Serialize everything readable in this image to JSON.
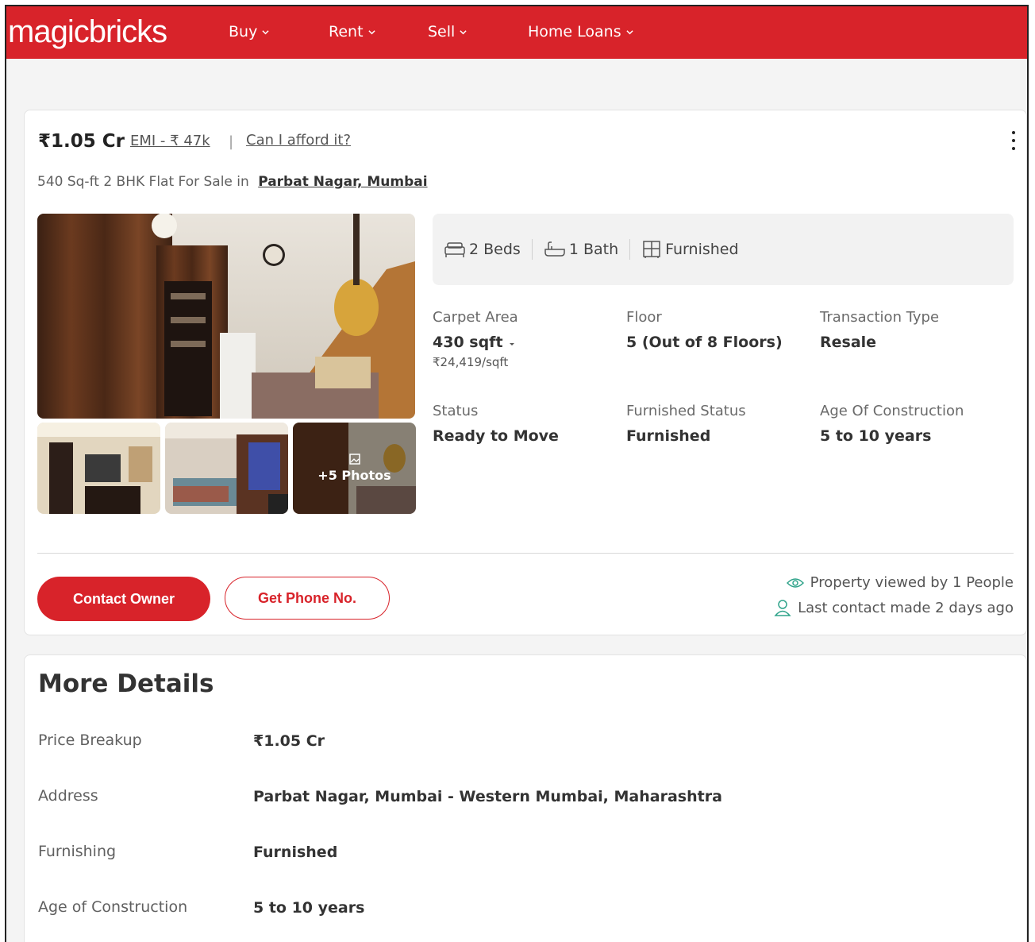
{
  "header": {
    "logo": "magicbricks",
    "nav": [
      "Buy",
      "Rent",
      "Sell",
      "Home Loans"
    ],
    "brand_color": "#d8232a"
  },
  "listing": {
    "price": "₹1.05 Cr",
    "emi": "EMI - ₹ 47k",
    "separator": "|",
    "afford": "Can I afford it?",
    "title": "540 Sq-ft 2 BHK Flat For Sale in",
    "location": "Parbat Nagar, Mumbai",
    "photos_label": "+5 Photos",
    "summary": {
      "beds": "2 Beds",
      "bath": "1 Bath",
      "furnished": "Furnished"
    },
    "attributes": {
      "carpet_area_label": "Carpet Area",
      "carpet_area_value": "430 sqft",
      "carpet_area_rate": "₹24,419/sqft",
      "floor_label": "Floor",
      "floor_value": "5 (Out of 8 Floors)",
      "transaction_label": "Transaction Type",
      "transaction_value": "Resale",
      "status_label": "Status",
      "status_value": "Ready to Move",
      "furnished_status_label": "Furnished Status",
      "furnished_status_value": "Furnished",
      "age_label": "Age Of Construction",
      "age_value": "5 to 10 years"
    },
    "actions": {
      "contact_owner": "Contact Owner",
      "get_phone": "Get Phone No."
    },
    "stats": {
      "viewed": "Property viewed by 1 People",
      "last_contact": "Last contact made 2 days ago"
    }
  },
  "more_details": {
    "title": "More Details",
    "rows": [
      {
        "label": "Price Breakup",
        "value": "₹1.05 Cr"
      },
      {
        "label": "Address",
        "value": "Parbat Nagar, Mumbai - Western Mumbai, Maharashtra"
      },
      {
        "label": "Furnishing",
        "value": "Furnished"
      },
      {
        "label": "Age of Construction",
        "value": "5 to 10 years"
      }
    ]
  }
}
